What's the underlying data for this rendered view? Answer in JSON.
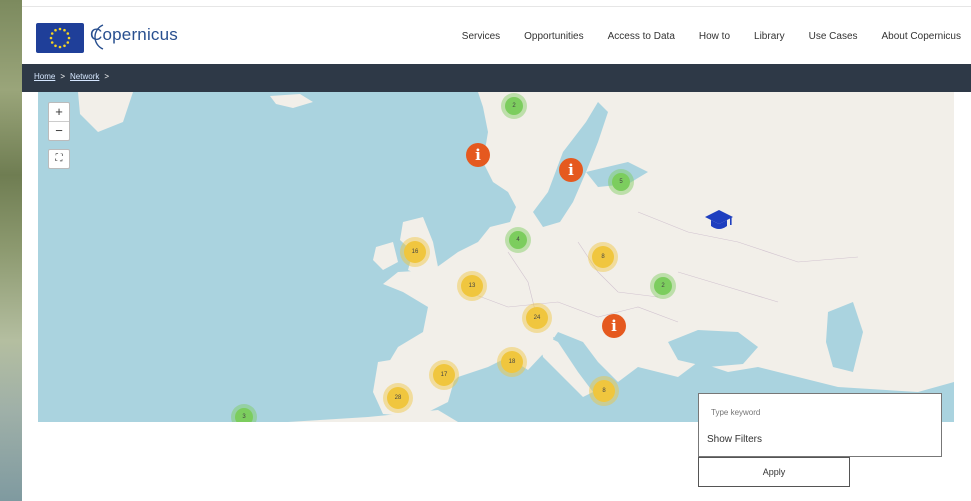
{
  "header": {
    "logo": {
      "wordmark": "Copernicus",
      "subtitle": ""
    },
    "nav": [
      "Services",
      "Opportunities",
      "Access to Data",
      "How to",
      "Library",
      "Use Cases",
      "About Copernicus"
    ]
  },
  "breadcrumb": {
    "items": [
      "Home",
      "Network"
    ],
    "separator": ">"
  },
  "map": {
    "zoom_in": "+",
    "zoom_out": "−",
    "fullscreen": "⛶",
    "clusters": [
      {
        "label": "2",
        "color": "green"
      },
      {
        "label": "5",
        "color": "green"
      },
      {
        "label": "4",
        "color": "green"
      },
      {
        "label": "2",
        "color": "green"
      },
      {
        "label": "3",
        "color": "green"
      },
      {
        "label": "16",
        "color": "yellow"
      },
      {
        "label": "13",
        "color": "yellow"
      },
      {
        "label": "8",
        "color": "yellow"
      },
      {
        "label": "24",
        "color": "yellow"
      },
      {
        "label": "18",
        "color": "yellow"
      },
      {
        "label": "17",
        "color": "yellow"
      },
      {
        "label": "28",
        "color": "yellow"
      },
      {
        "label": "8",
        "color": "yellow"
      }
    ],
    "info_pins": [
      "i",
      "i",
      "i"
    ],
    "colors": {
      "sea": "#aad3df",
      "land": "#f2efe9",
      "cluster_yellow": "#f0c63e",
      "cluster_green": "#7ccd5e",
      "pin": "#e5591f",
      "edu": "#1f3fbf"
    }
  },
  "filter": {
    "keyword_placeholder": "Type keyword",
    "show_filters": "Show Filters",
    "apply": "Apply"
  },
  "colors": {
    "header_bar": "#2e3947",
    "brand": "#284f8f",
    "eu_blue": "#1f3f99"
  }
}
